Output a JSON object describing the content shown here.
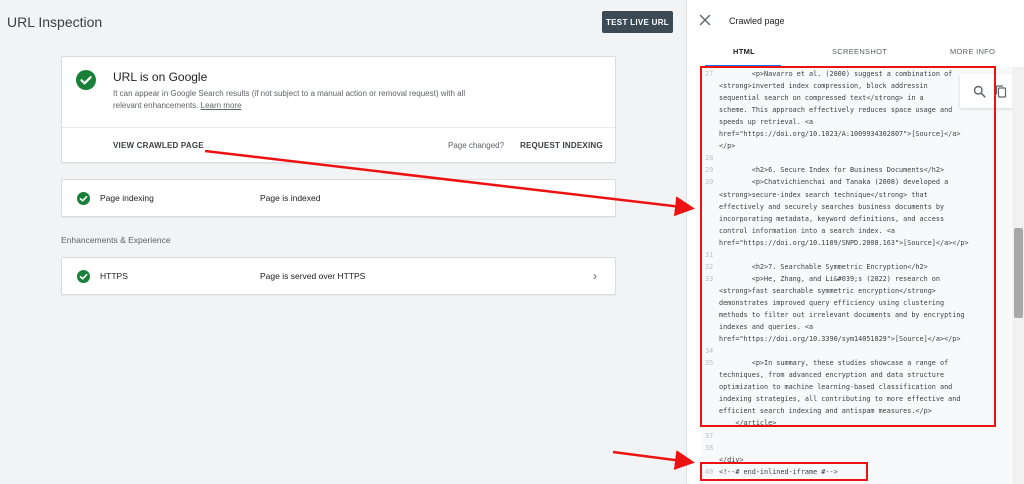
{
  "page": {
    "title": "URL Inspection",
    "test_live_url": "TEST LIVE URL"
  },
  "summary_card": {
    "title": "URL is on Google",
    "description": "It can appear in Google Search results (if not subject to a manual action or removal request) with all relevant enhancements.",
    "learn_more": "Learn more",
    "view_crawled_page": "VIEW CRAWLED PAGE",
    "page_changed": "Page changed?",
    "request_indexing": "REQUEST INDEXING"
  },
  "page_indexing": {
    "label": "Page indexing",
    "status": "Page is indexed"
  },
  "enhancements": {
    "heading": "Enhancements & Experience",
    "https": {
      "label": "HTTPS",
      "status": "Page is served over HTTPS"
    }
  },
  "panel": {
    "title": "Crawled page",
    "tabs": [
      "HTML",
      "SCREENSHOT",
      "MORE INFO"
    ],
    "active_tab": "HTML"
  },
  "code_lines": [
    {
      "n": "27",
      "t": "        <p>Navarro et al. (2000) suggest a combination of"
    },
    {
      "n": "",
      "t": "<strong>inverted index compression, block addressin"
    },
    {
      "n": "",
      "t": "sequential search on compressed text</strong> in a"
    },
    {
      "n": "",
      "t": "scheme. This approach effectively reduces space usage and"
    },
    {
      "n": "",
      "t": "speeds up retrieval. <a"
    },
    {
      "n": "",
      "t": "href=\"https://doi.org/10.1023/A:1009934302807\">[Source]</a>"
    },
    {
      "n": "",
      "t": "</p>"
    },
    {
      "n": "28",
      "t": ""
    },
    {
      "n": "29",
      "t": "        <h2>6. Secure Index for Business Documents</h2>"
    },
    {
      "n": "30",
      "t": "        <p>Chatvichienchai and Tanaka (2008) developed a"
    },
    {
      "n": "",
      "t": "<strong>secure-index search technique</strong> that"
    },
    {
      "n": "",
      "t": "effectively and securely searches business documents by"
    },
    {
      "n": "",
      "t": "incorporating metadata, keyword definitions, and access"
    },
    {
      "n": "",
      "t": "control information into a search index. <a"
    },
    {
      "n": "",
      "t": "href=\"https://doi.org/10.1109/SNPD.2008.163\">[Source]</a></p>"
    },
    {
      "n": "31",
      "t": ""
    },
    {
      "n": "32",
      "t": "        <h2>7. Searchable Symmetric Encryption</h2>"
    },
    {
      "n": "33",
      "t": "        <p>He, Zhang, and Li&#039;s (2022) research on"
    },
    {
      "n": "",
      "t": "<strong>fast searchable symmetric encryption</strong>"
    },
    {
      "n": "",
      "t": "demonstrates improved query efficiency using clustering"
    },
    {
      "n": "",
      "t": "methods to filter out irrelevant documents and by encrypting"
    },
    {
      "n": "",
      "t": "indexes and queries. <a"
    },
    {
      "n": "",
      "t": "href=\"https://doi.org/10.3390/sym14051029\">[Source]</a></p>"
    },
    {
      "n": "34",
      "t": ""
    },
    {
      "n": "35",
      "t": "        <p>In summary, these studies showcase a range of"
    },
    {
      "n": "",
      "t": "techniques, from advanced encryption and data structure"
    },
    {
      "n": "",
      "t": "optimization to machine learning-based classification and"
    },
    {
      "n": "",
      "t": "indexing strategies, all contributing to more effective and"
    },
    {
      "n": "",
      "t": "efficient search indexing and antispam measures.</p>"
    },
    {
      "n": "",
      "t": "    </article>"
    },
    {
      "n": "37",
      "t": ""
    },
    {
      "n": "38",
      "t": ""
    },
    {
      "n": "",
      "t": "</div>"
    },
    {
      "n": "40",
      "t": "<!--# end-inlined-iframe #-->"
    }
  ]
}
